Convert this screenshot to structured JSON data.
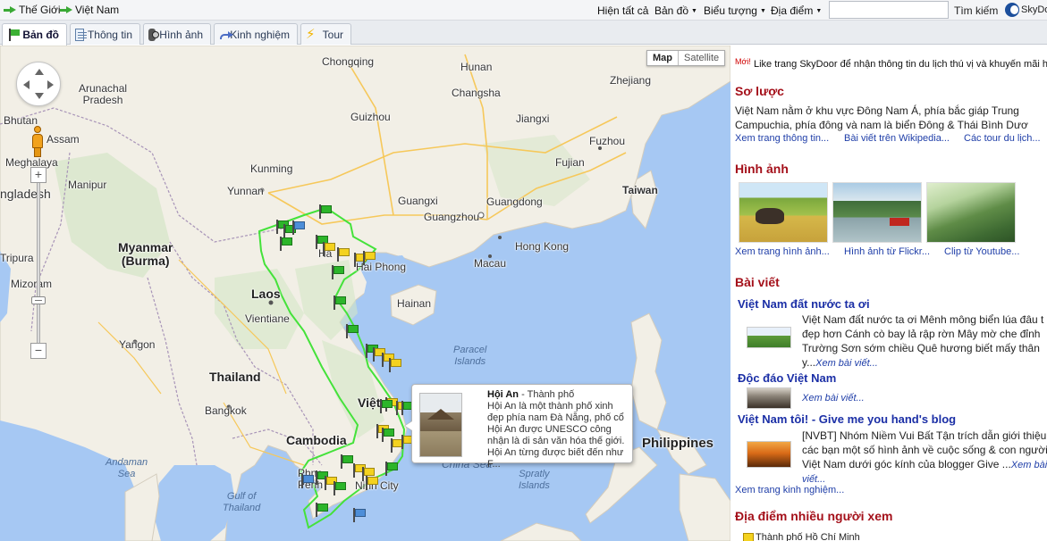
{
  "breadcrumb": [
    "Thế Giới",
    "Việt Nam"
  ],
  "topmenu": {
    "show_all": "Hiện tất cả",
    "map": "Bản đồ",
    "symbols": "Biểu tượng",
    "places": "Địa điểm",
    "search_value": "",
    "search_button": "Tìm kiếm",
    "brand": "SkyDo"
  },
  "tabs": [
    "Bản đồ",
    "Thông tin",
    "Hình ảnh",
    "Kinh nghiệm",
    "Tour"
  ],
  "map": {
    "type_buttons": [
      "Map",
      "Satellite"
    ],
    "zoom_in": "+",
    "zoom_out": "−",
    "labels": {
      "bhutan": "Bhutan",
      "assam": "Assam",
      "meghalaya": "Meghalaya",
      "bangladesh": "ngladesh",
      "manipur": "Manipur",
      "tripura": "Tripura",
      "mizoram": "Mizoram",
      "arunachal": "Arunachal\nPradesh",
      "chongqing": "Chongqing",
      "guizhou": "Guizhou",
      "hunan": "Hunan",
      "changsha": "Changsha",
      "jiangxi": "Jiangxi",
      "fujian": "Fujian",
      "fuzhou": "Fuzhou",
      "zhejiang": "Zhejiang",
      "kunming": "Kunming",
      "yunnan": "Yunnan",
      "guangxi": "Guangxi",
      "guangdong": "Guangdong",
      "guangzhou": "Guangzhou",
      "taiwan": "Taiwan",
      "hongkong": "Hong Kong",
      "macau": "Macau",
      "myanmar": "Myanmar\n(Burma)",
      "laos": "Laos",
      "vientiane": "Vientiane",
      "yangon": "Yangon",
      "thailand": "Thailand",
      "bangkok": "Bangkok",
      "cambodia": "Cambodia",
      "phnompenh": "Phno\nPenh",
      "hanoi": "Ha",
      "haiphong": "Hai Phong",
      "hainan": "Hainan",
      "vietnam": "Việt",
      "hcmc": "Ninh City",
      "paracel": "Paracel\nIslands",
      "spratly": "Spratly\nIslands",
      "southchinasea": "China Sea",
      "philippines": "Philippines",
      "andaman": "Andaman\nSea",
      "gulfthailand": "Gulf of\nThailand"
    },
    "info": {
      "name": "Hội An",
      "type": " - Thành phố",
      "desc": "Hội An là một thành phố xinh đẹp phía nam Đà Nẵng, phố cổ Hội An được UNESCO công nhận là di sản văn hóa thế giới. Hội An từng được biết đến như F..."
    }
  },
  "panel": {
    "notice_new": "Mới!",
    "notice": "Like trang SkyDoor để nhận thông tin du lịch thú vị và khuyến mãi hấp",
    "overview_title": "Sơ lược",
    "overview_line1": "Việt Nam nằm ở khu vực Đông Nam Á, phía bắc giáp Trung",
    "overview_line2": "Campuchia, phía đông và nam là biển Đông & Thái Bình Dươ",
    "overview_links": [
      "Xem trang thông tin...",
      "Bài viết trên Wikipedia...",
      "Các tour du lịch..."
    ],
    "images_title": "Hình ảnh",
    "images_links": [
      "Xem trang hình ảnh...",
      "Hình ảnh từ Flickr...",
      "Clip từ Youtube..."
    ],
    "articles_title": "Bài viết",
    "articles": [
      {
        "title": "Việt Nam đất nước ta ơi",
        "lines": [
          "Việt Nam đất nước ta ơi Mênh mông biển lúa đâu t",
          "đẹp hơn Cánh cò bay lả rập rờn Mây mờ che đỉnh",
          "Trường Sơn sớm chiều Quê hương biết mấy thân",
          "y..."
        ],
        "more": "Xem bài viết..."
      },
      {
        "title": "Độc đáo Việt Nam",
        "lines": [
          ""
        ],
        "more": "Xem bài viết..."
      },
      {
        "title": "Việt Nam tôi! - Give me you hand's blog",
        "lines": [
          "[NVBT] Nhóm Niềm Vui Bất Tận trích dẫn giới thiệu",
          "các bạn một số hình ảnh về cuộc sống & con người",
          "Việt Nam dưới góc kính của blogger Give ...",
          "viết..."
        ],
        "more": "Xem bài"
      }
    ],
    "experience_link": "Xem trang kinh nghiệm...",
    "popular_title": "Địa điểm nhiều người xem",
    "popular_place": "Thành phố Hồ Chí Minh"
  }
}
